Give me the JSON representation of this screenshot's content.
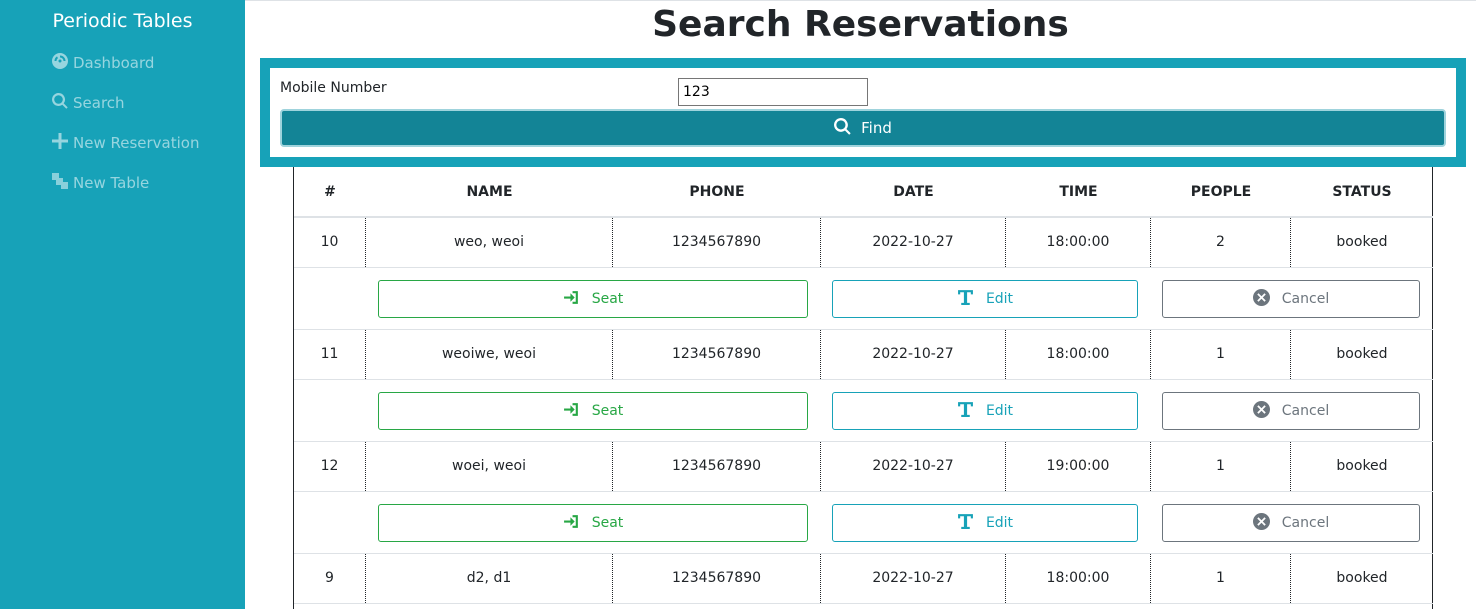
{
  "sidebar": {
    "brand": "Periodic Tables",
    "items": [
      {
        "label": "Dashboard",
        "icon": "dashboard-icon"
      },
      {
        "label": "Search",
        "icon": "search-icon"
      },
      {
        "label": "New Reservation",
        "icon": "plus-icon"
      },
      {
        "label": "New Table",
        "icon": "layers-icon"
      }
    ]
  },
  "page": {
    "title": "Search Reservations"
  },
  "search_form": {
    "label": "Mobile Number",
    "value": "123",
    "find_label": "Find"
  },
  "table": {
    "headers": [
      "#",
      "NAME",
      "PHONE",
      "DATE",
      "TIME",
      "PEOPLE",
      "STATUS"
    ],
    "rows": [
      {
        "id": "10",
        "name": "weo, weoi",
        "phone": "1234567890",
        "date": "2022-10-27",
        "time": "18:00:00",
        "people": "2",
        "status": "booked"
      },
      {
        "id": "11",
        "name": "weoiwe, weoi",
        "phone": "1234567890",
        "date": "2022-10-27",
        "time": "18:00:00",
        "people": "1",
        "status": "booked"
      },
      {
        "id": "12",
        "name": "woei, weoi",
        "phone": "1234567890",
        "date": "2022-10-27",
        "time": "19:00:00",
        "people": "1",
        "status": "booked"
      },
      {
        "id": "9",
        "name": "d2, d1",
        "phone": "1234567890",
        "date": "2022-10-27",
        "time": "18:00:00",
        "people": "1",
        "status": "booked"
      }
    ],
    "actions": {
      "seat": "Seat",
      "edit": "Edit",
      "cancel": "Cancel"
    }
  },
  "colors": {
    "sidebar": "#17a2b8",
    "find_button": "#138496",
    "seat": "#28a745",
    "edit": "#17a2b8",
    "cancel": "#6c757d"
  }
}
